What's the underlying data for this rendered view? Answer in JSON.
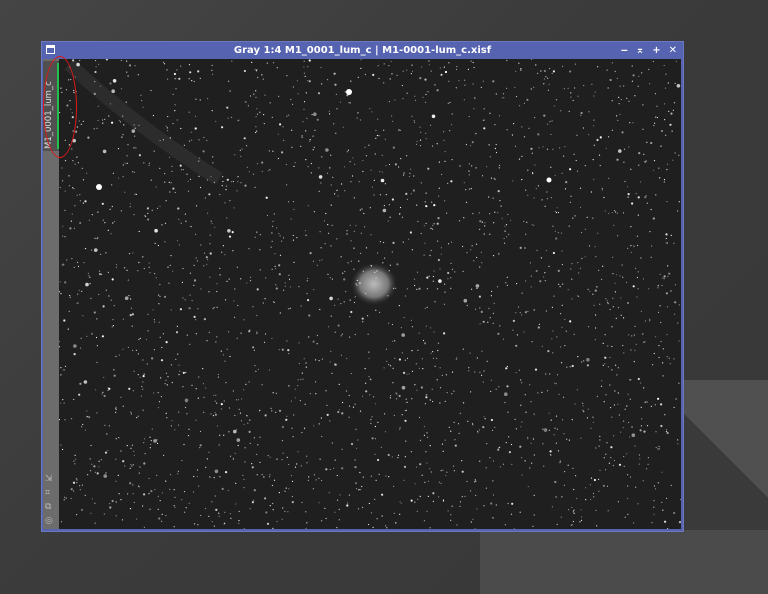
{
  "window": {
    "title": "Gray 1:4 M1_0001_lum_c | M1-0001-lum_c.xisf",
    "controls": {
      "shade": "‒",
      "minimize": "⌅",
      "maximize": "+",
      "close": "✕"
    },
    "view_tab_label": "M1_0001_lum_c",
    "tab_color": "#22c04a",
    "titlebar_color": "#5563b0"
  },
  "annotation": {
    "color": "#e01818",
    "shape": "ellipse"
  },
  "side_icons": [
    "arrow-diagonal-icon",
    "fit-view-icon",
    "clone-icon",
    "target-icon"
  ]
}
